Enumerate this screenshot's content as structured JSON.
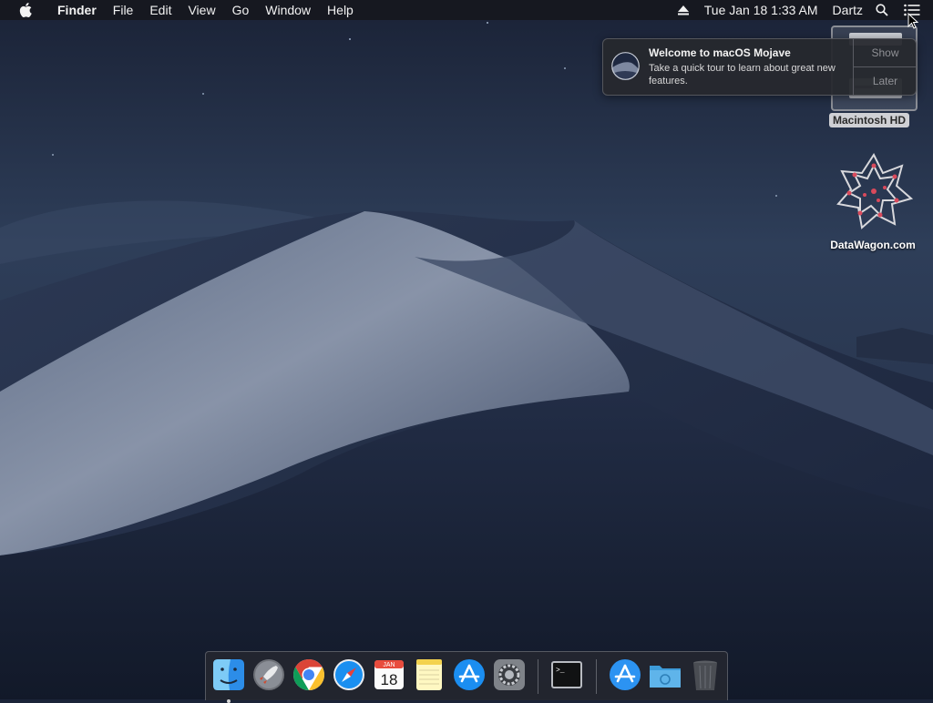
{
  "menubar": {
    "app_name": "Finder",
    "menus": [
      "File",
      "Edit",
      "View",
      "Go",
      "Window",
      "Help"
    ],
    "icons": [
      "apple-logo",
      "eject-icon",
      "spotlight-search-icon",
      "notification-center-icon"
    ],
    "clock": "Tue Jan 18  1:33 AM",
    "user": "Dartz"
  },
  "notification": {
    "title": "Welcome to macOS Mojave",
    "body": "Take a quick tour to learn about great new features.",
    "show_label": "Show",
    "later_label": "Later"
  },
  "desktop": {
    "hd_label": "Macintosh HD",
    "website_label": "DataWagon.com"
  },
  "dock": {
    "apps": [
      "Finder",
      "Launchpad",
      "Chrome",
      "Safari",
      "Calendar",
      "Notes",
      "App Store",
      "System Preferences",
      "Terminal",
      "Applications",
      "Downloads",
      "Trash"
    ],
    "calendar_month": "JAN",
    "calendar_day": "18"
  },
  "colors": {
    "menubar_bg": "#16181e",
    "notification_bg": "#26282e",
    "desktop_sky": "#1b2438"
  }
}
